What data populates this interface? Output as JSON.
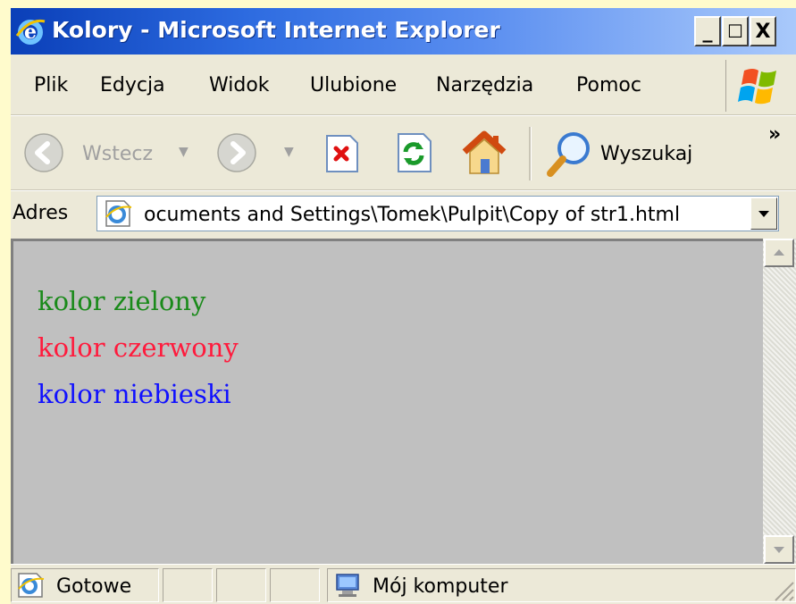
{
  "window": {
    "title": "Kolory - Microsoft Internet Explorer",
    "minimize": "_",
    "maximize": "☐",
    "close": "X"
  },
  "menu": [
    "Plik",
    "Edycja",
    "Widok",
    "Ulubione",
    "Narzędzia",
    "Pomoc"
  ],
  "toolbar": {
    "back_label": "Wstecz",
    "search_label": "Wyszukaj",
    "overflow": "»"
  },
  "address": {
    "label": "Adres",
    "value": "ocuments and Settings\\Tomek\\Pulpit\\Copy of str1.html"
  },
  "content": {
    "lines": [
      {
        "text": "kolor zielony",
        "color": "#1a8a1a"
      },
      {
        "text": "kolor czerwony",
        "color": "#ff1a3c"
      },
      {
        "text": "kolor niebieski",
        "color": "#1010ff"
      }
    ]
  },
  "status": {
    "text": "Gotowe",
    "zone": "Mój komputer"
  },
  "colors": {
    "page_background": "#fffbcc",
    "content_background": "#c0c0c0",
    "titlebar_start": "#0a3fb8"
  }
}
